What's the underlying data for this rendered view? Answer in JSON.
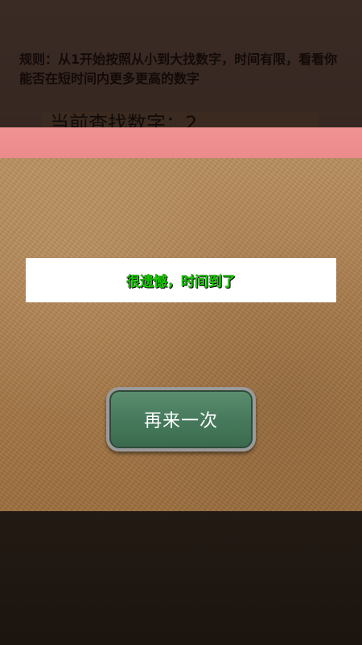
{
  "background": {
    "rules_text": "规则：从1开始按照从小到大找数字，时间有限，看看你能否在短时间内更多更高的数字",
    "current_target_text": "当前查找数字：2"
  },
  "popup": {
    "message": "很遗憾，时间到了",
    "retry_label": "再来一次"
  },
  "colors": {
    "header": "#ec8a8a",
    "message_text": "#19c800",
    "button_green": "#477a5c"
  }
}
